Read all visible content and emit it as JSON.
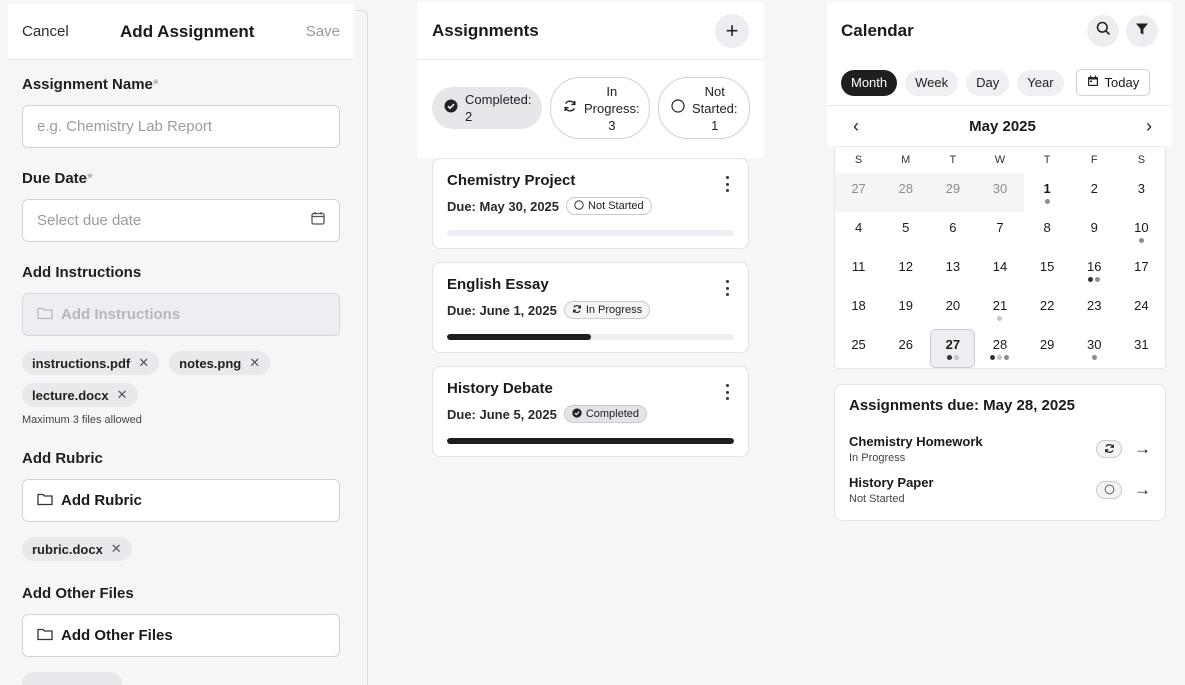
{
  "form": {
    "cancel_label": "Cancel",
    "title": "Add Assignment",
    "save_label": "Save",
    "name_label": "Assignment Name",
    "name_placeholder": "e.g. Chemistry Lab Report",
    "due_label": "Due Date",
    "due_placeholder": "Select due date",
    "required_mark": "*",
    "instructions_label": "Add Instructions",
    "instructions_button": "Add Instructions",
    "instruction_files": [
      "instructions.pdf",
      "notes.png",
      "lecture.docx"
    ],
    "files_hint": "Maximum 3 files allowed",
    "rubric_label": "Add Rubric",
    "rubric_button": "Add Rubric",
    "rubric_files": [
      "rubric.docx"
    ],
    "other_label": "Add Other Files",
    "other_button": "Add Other Files"
  },
  "assignments": {
    "title": "Assignments",
    "add_icon": "plus-icon",
    "filters": [
      {
        "line1": "Completed:",
        "line2": "2",
        "icon": "check-circle-icon"
      },
      {
        "line1": "In",
        "line2": "Progress:",
        "line3": "3",
        "icon": "refresh-icon"
      },
      {
        "line1": "Not",
        "line2": "Started:",
        "line3": "1",
        "icon": "empty-circle-icon"
      }
    ],
    "cards": [
      {
        "title": "Chemistry Project",
        "due": "Due: May 30, 2025",
        "status": "Not Started",
        "progress": 0
      },
      {
        "title": "English Essay",
        "due": "Due: June 1, 2025",
        "status": "In Progress",
        "progress": 0.5
      },
      {
        "title": "History Debate",
        "due": "Due: June 5, 2025",
        "status": "Completed",
        "progress": 1.0
      }
    ]
  },
  "calendar": {
    "title": "Calendar",
    "views": [
      "Month",
      "Week",
      "Day",
      "Year"
    ],
    "active_view": "Month",
    "today_label": "Today",
    "month_label": "May 2025",
    "weekdays": [
      "S",
      "M",
      "T",
      "W",
      "T",
      "F",
      "S"
    ],
    "weeks": [
      [
        {
          "d": "27",
          "muted": true
        },
        {
          "d": "28",
          "muted": true
        },
        {
          "d": "29",
          "muted": true
        },
        {
          "d": "30",
          "muted": true
        },
        {
          "d": "1",
          "bold": true,
          "dots": [
            "#8a8d92"
          ]
        },
        {
          "d": "2"
        },
        {
          "d": "3"
        }
      ],
      [
        {
          "d": "4"
        },
        {
          "d": "5"
        },
        {
          "d": "6"
        },
        {
          "d": "7"
        },
        {
          "d": "8"
        },
        {
          "d": "9"
        },
        {
          "d": "10",
          "dots": [
            "#8a8d92"
          ]
        }
      ],
      [
        {
          "d": "11"
        },
        {
          "d": "12"
        },
        {
          "d": "13"
        },
        {
          "d": "14"
        },
        {
          "d": "15"
        },
        {
          "d": "16",
          "dots": [
            "#333333",
            "#8a8d92"
          ]
        },
        {
          "d": "17"
        }
      ],
      [
        {
          "d": "18"
        },
        {
          "d": "19"
        },
        {
          "d": "20"
        },
        {
          "d": "21",
          "dots": [
            "#c2c4c8"
          ]
        },
        {
          "d": "22"
        },
        {
          "d": "23"
        },
        {
          "d": "24"
        }
      ],
      [
        {
          "d": "25"
        },
        {
          "d": "26"
        },
        {
          "d": "27",
          "bold": true,
          "selected": true,
          "dots": [
            "#333333",
            "#c2c4c8"
          ]
        },
        {
          "d": "28",
          "dots": [
            "#333333",
            "#c2c4c8",
            "#8a8d92"
          ]
        },
        {
          "d": "29"
        },
        {
          "d": "30",
          "dots": [
            "#8a8d92"
          ]
        },
        {
          "d": "31"
        }
      ]
    ],
    "due_title": "Assignments due: May 28, 2025",
    "due_items": [
      {
        "name": "Chemistry Homework",
        "status": "In Progress",
        "icon": "refresh-icon"
      },
      {
        "name": "History Paper",
        "status": "Not Started",
        "icon": "empty-circle-icon"
      }
    ]
  }
}
